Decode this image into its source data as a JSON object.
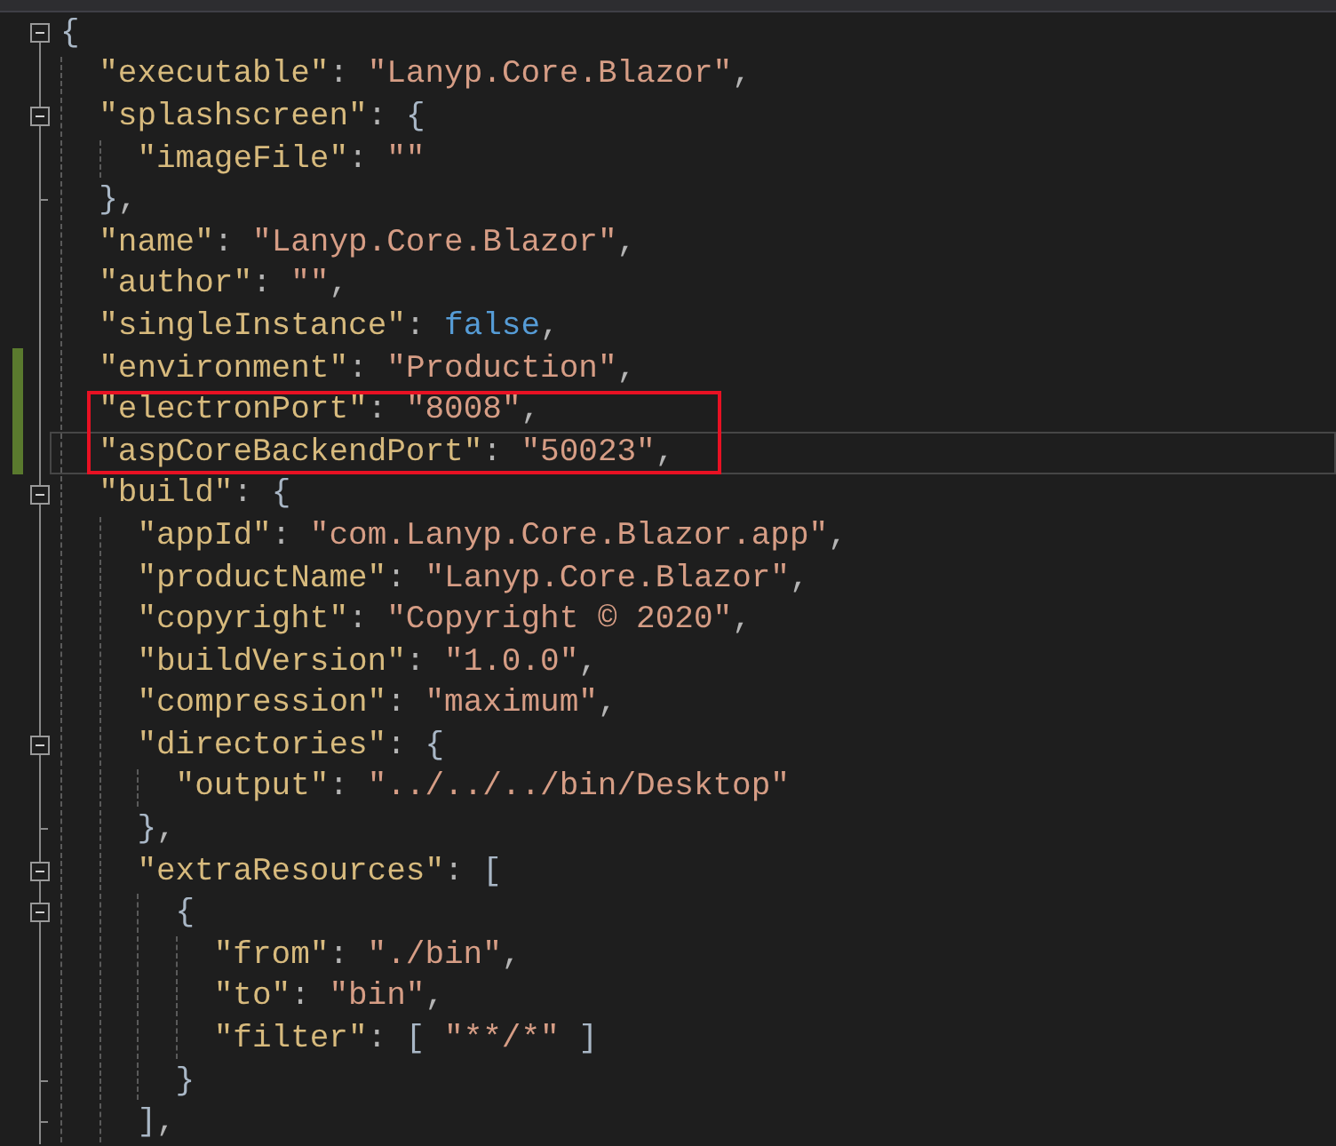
{
  "lines": [
    {
      "changed": false,
      "current": false,
      "boxed": false,
      "tokens": [
        {
          "kind": "bracket",
          "text": "{"
        }
      ],
      "children": [
        {
          "changed": false,
          "current": false,
          "boxed": false,
          "tokens": [
            {
              "kind": "key",
              "text": "\"executable\""
            },
            {
              "kind": "punct",
              "text": ": "
            },
            {
              "kind": "string",
              "text": "\"Lanyp.Core.Blazor\""
            },
            {
              "kind": "punct",
              "text": ","
            }
          ]
        },
        {
          "changed": false,
          "current": false,
          "boxed": false,
          "tokens": [
            {
              "kind": "key",
              "text": "\"splashscreen\""
            },
            {
              "kind": "punct",
              "text": ": "
            },
            {
              "kind": "bracket",
              "text": "{"
            }
          ],
          "close": [
            {
              "kind": "bracket",
              "text": "}"
            },
            {
              "kind": "punct",
              "text": ","
            }
          ],
          "children": [
            {
              "changed": false,
              "current": false,
              "boxed": false,
              "tokens": [
                {
                  "kind": "key",
                  "text": "\"imageFile\""
                },
                {
                  "kind": "punct",
                  "text": ": "
                },
                {
                  "kind": "string",
                  "text": "\"\""
                }
              ]
            }
          ]
        },
        {
          "changed": false,
          "current": false,
          "boxed": false,
          "tokens": [
            {
              "kind": "key",
              "text": "\"name\""
            },
            {
              "kind": "punct",
              "text": ": "
            },
            {
              "kind": "string",
              "text": "\"Lanyp.Core.Blazor\""
            },
            {
              "kind": "punct",
              "text": ","
            }
          ]
        },
        {
          "changed": false,
          "current": false,
          "boxed": false,
          "tokens": [
            {
              "kind": "key",
              "text": "\"author\""
            },
            {
              "kind": "punct",
              "text": ": "
            },
            {
              "kind": "string",
              "text": "\"\""
            },
            {
              "kind": "punct",
              "text": ","
            }
          ]
        },
        {
          "changed": false,
          "current": false,
          "boxed": false,
          "tokens": [
            {
              "kind": "key",
              "text": "\"singleInstance\""
            },
            {
              "kind": "punct",
              "text": ": "
            },
            {
              "kind": "literal",
              "text": "false"
            },
            {
              "kind": "punct",
              "text": ","
            }
          ]
        },
        {
          "changed": true,
          "current": false,
          "boxed": false,
          "tokens": [
            {
              "kind": "key",
              "text": "\"environment\""
            },
            {
              "kind": "punct",
              "text": ": "
            },
            {
              "kind": "string",
              "text": "\"Production\""
            },
            {
              "kind": "punct",
              "text": ","
            }
          ]
        },
        {
          "changed": true,
          "current": false,
          "boxed": true,
          "tokens": [
            {
              "kind": "key",
              "text": "\"electronPort\""
            },
            {
              "kind": "punct",
              "text": ": "
            },
            {
              "kind": "string",
              "text": "\"8008\""
            },
            {
              "kind": "punct",
              "text": ","
            }
          ]
        },
        {
          "changed": true,
          "current": true,
          "boxed": true,
          "tokens": [
            {
              "kind": "key",
              "text": "\"aspCoreBackendPort\""
            },
            {
              "kind": "punct",
              "text": ": "
            },
            {
              "kind": "string",
              "text": "\"50023\""
            },
            {
              "kind": "punct",
              "text": ","
            }
          ]
        },
        {
          "changed": false,
          "current": false,
          "boxed": false,
          "tokens": [
            {
              "kind": "key",
              "text": "\"build\""
            },
            {
              "kind": "punct",
              "text": ": "
            },
            {
              "kind": "bracket",
              "text": "{"
            }
          ],
          "children": [
            {
              "changed": false,
              "current": false,
              "boxed": false,
              "tokens": [
                {
                  "kind": "key",
                  "text": "\"appId\""
                },
                {
                  "kind": "punct",
                  "text": ": "
                },
                {
                  "kind": "string",
                  "text": "\"com.Lanyp.Core.Blazor.app\""
                },
                {
                  "kind": "punct",
                  "text": ","
                }
              ]
            },
            {
              "changed": false,
              "current": false,
              "boxed": false,
              "tokens": [
                {
                  "kind": "key",
                  "text": "\"productName\""
                },
                {
                  "kind": "punct",
                  "text": ": "
                },
                {
                  "kind": "string",
                  "text": "\"Lanyp.Core.Blazor\""
                },
                {
                  "kind": "punct",
                  "text": ","
                }
              ]
            },
            {
              "changed": false,
              "current": false,
              "boxed": false,
              "tokens": [
                {
                  "kind": "key",
                  "text": "\"copyright\""
                },
                {
                  "kind": "punct",
                  "text": ": "
                },
                {
                  "kind": "string",
                  "text": "\"Copyright © 2020\""
                },
                {
                  "kind": "punct",
                  "text": ","
                }
              ]
            },
            {
              "changed": false,
              "current": false,
              "boxed": false,
              "tokens": [
                {
                  "kind": "key",
                  "text": "\"buildVersion\""
                },
                {
                  "kind": "punct",
                  "text": ": "
                },
                {
                  "kind": "string",
                  "text": "\"1.0.0\""
                },
                {
                  "kind": "punct",
                  "text": ","
                }
              ]
            },
            {
              "changed": false,
              "current": false,
              "boxed": false,
              "tokens": [
                {
                  "kind": "key",
                  "text": "\"compression\""
                },
                {
                  "kind": "punct",
                  "text": ": "
                },
                {
                  "kind": "string",
                  "text": "\"maximum\""
                },
                {
                  "kind": "punct",
                  "text": ","
                }
              ]
            },
            {
              "changed": false,
              "current": false,
              "boxed": false,
              "tokens": [
                {
                  "kind": "key",
                  "text": "\"directories\""
                },
                {
                  "kind": "punct",
                  "text": ": "
                },
                {
                  "kind": "bracket",
                  "text": "{"
                }
              ],
              "close": [
                {
                  "kind": "bracket",
                  "text": "}"
                },
                {
                  "kind": "punct",
                  "text": ","
                }
              ],
              "children": [
                {
                  "changed": false,
                  "current": false,
                  "boxed": false,
                  "tokens": [
                    {
                      "kind": "key",
                      "text": "\"output\""
                    },
                    {
                      "kind": "punct",
                      "text": ": "
                    },
                    {
                      "kind": "string",
                      "text": "\"../../../bin/Desktop\""
                    }
                  ]
                }
              ]
            },
            {
              "changed": false,
              "current": false,
              "boxed": false,
              "tokens": [
                {
                  "kind": "key",
                  "text": "\"extraResources\""
                },
                {
                  "kind": "punct",
                  "text": ": "
                },
                {
                  "kind": "bracket",
                  "text": "["
                }
              ],
              "close": [
                {
                  "kind": "bracket",
                  "text": "]"
                },
                {
                  "kind": "punct",
                  "text": ","
                }
              ],
              "children": [
                {
                  "changed": false,
                  "current": false,
                  "boxed": false,
                  "tokens": [
                    {
                      "kind": "bracket",
                      "text": "{"
                    }
                  ],
                  "close": [
                    {
                      "kind": "bracket",
                      "text": "}"
                    }
                  ],
                  "children": [
                    {
                      "changed": false,
                      "current": false,
                      "boxed": false,
                      "tokens": [
                        {
                          "kind": "key",
                          "text": "\"from\""
                        },
                        {
                          "kind": "punct",
                          "text": ": "
                        },
                        {
                          "kind": "string",
                          "text": "\"./bin\""
                        },
                        {
                          "kind": "punct",
                          "text": ","
                        }
                      ]
                    },
                    {
                      "changed": false,
                      "current": false,
                      "boxed": false,
                      "tokens": [
                        {
                          "kind": "key",
                          "text": "\"to\""
                        },
                        {
                          "kind": "punct",
                          "text": ": "
                        },
                        {
                          "kind": "string",
                          "text": "\"bin\""
                        },
                        {
                          "kind": "punct",
                          "text": ","
                        }
                      ]
                    },
                    {
                      "changed": false,
                      "current": false,
                      "boxed": false,
                      "tokens": [
                        {
                          "kind": "key",
                          "text": "\"filter\""
                        },
                        {
                          "kind": "punct",
                          "text": ": "
                        },
                        {
                          "kind": "bracket",
                          "text": "[ "
                        },
                        {
                          "kind": "string",
                          "text": "\"**/*\""
                        },
                        {
                          "kind": "bracket",
                          "text": " ]"
                        }
                      ]
                    }
                  ]
                }
              ]
            }
          ]
        }
      ]
    }
  ]
}
